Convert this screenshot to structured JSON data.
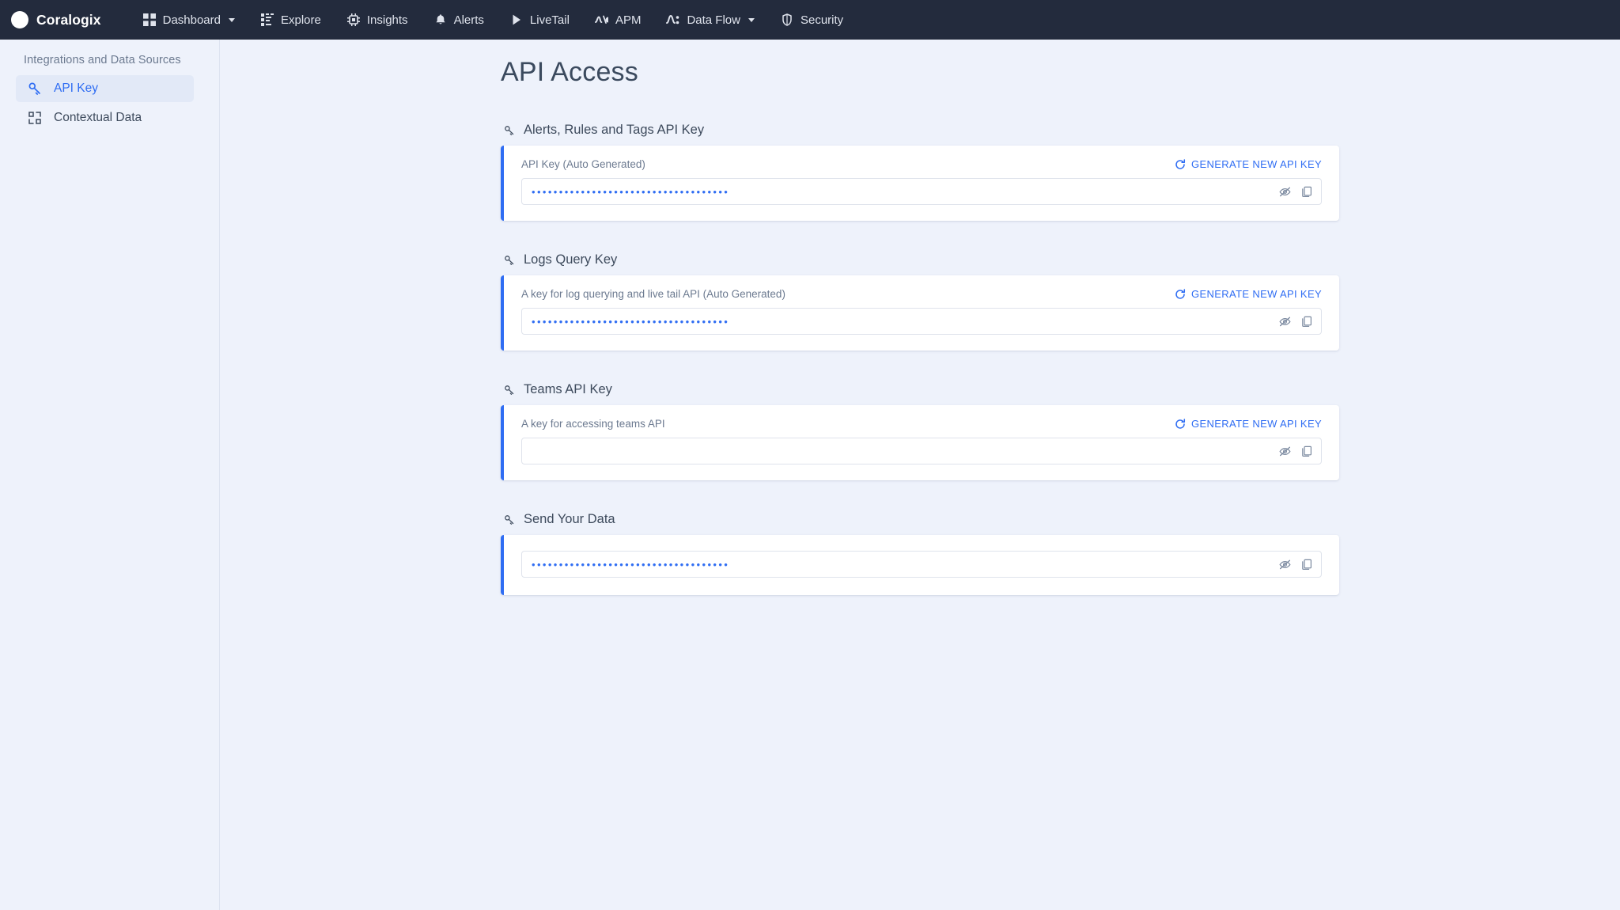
{
  "topnav": {
    "brand": "Coralogix",
    "items": [
      {
        "label": "Dashboard",
        "icon": "grid-icon",
        "caret": true
      },
      {
        "label": "Explore",
        "icon": "explore-icon",
        "caret": false
      },
      {
        "label": "Insights",
        "icon": "insights-chip-icon",
        "caret": false
      },
      {
        "label": "Alerts",
        "icon": "bell-icon",
        "caret": false
      },
      {
        "label": "LiveTail",
        "icon": "play-icon",
        "caret": false
      },
      {
        "label": "APM",
        "icon": "apm-icon",
        "caret": false
      },
      {
        "label": "Data Flow",
        "icon": "data-flow-icon",
        "caret": true
      },
      {
        "label": "Security",
        "icon": "shield-icon",
        "caret": false
      }
    ]
  },
  "sidebar": {
    "title": "Integrations and Data Sources",
    "items": [
      {
        "label": "API Key",
        "icon": "key-icon",
        "active": true
      },
      {
        "label": "Contextual Data",
        "icon": "contextual-data-icon",
        "active": false
      }
    ]
  },
  "page": {
    "title": "API Access"
  },
  "sections": [
    {
      "title": "Alerts, Rules and Tags API Key",
      "icon": "key-icon",
      "description": "API Key (Auto Generated)",
      "generate_label": "GENERATE NEW API KEY",
      "has_generate": true,
      "has_description": true,
      "value": "••••••••••••••••••••••••••••••••••••",
      "masked": true
    },
    {
      "title": "Logs Query Key",
      "icon": "key-icon",
      "description": "A key for log querying and live tail API (Auto Generated)",
      "generate_label": "GENERATE NEW API KEY",
      "has_generate": true,
      "has_description": true,
      "value": "••••••••••••••••••••••••••••••••••••",
      "masked": true
    },
    {
      "title": "Teams API Key",
      "icon": "key-icon",
      "description": "A key for accessing teams API",
      "generate_label": "GENERATE NEW API KEY",
      "has_generate": true,
      "has_description": true,
      "value": "",
      "masked": true
    },
    {
      "title": "Send Your Data",
      "icon": "key-icon",
      "description": "",
      "generate_label": "",
      "has_generate": false,
      "has_description": false,
      "value": "••••••••••••••••••••••••••••••••••••",
      "masked": true
    }
  ],
  "field_icons": {
    "toggle_visibility": "eye-off-icon",
    "copy": "copy-icon"
  },
  "colors": {
    "nav_bg": "#232b3d",
    "page_bg": "#eef2fb",
    "accent": "#2f6df3",
    "text": "#3d4a5c",
    "muted": "#6c7a90",
    "card_bg": "#ffffff"
  }
}
